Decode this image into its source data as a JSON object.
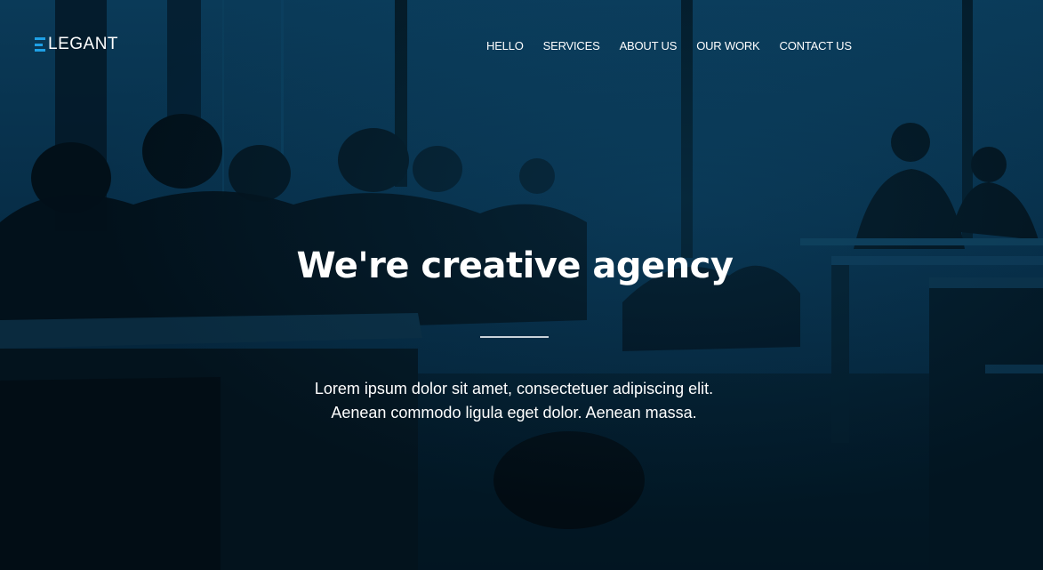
{
  "brand": {
    "logo_text": "LEGANT",
    "accent_color": "#1ea0e6"
  },
  "nav": {
    "items": [
      {
        "label": "HELLO"
      },
      {
        "label": "SERVICES"
      },
      {
        "label": "ABOUT US"
      },
      {
        "label": "OUR WORK"
      },
      {
        "label": "CONTACT US"
      }
    ]
  },
  "hero": {
    "headline": "We're creative agency",
    "subtext_line1": "Lorem ipsum dolor sit amet, consectetuer adipiscing elit.",
    "subtext_line2": "Aenean commodo ligula eget dolor. Aenean massa.",
    "overlay_color": "#0a3a58"
  }
}
